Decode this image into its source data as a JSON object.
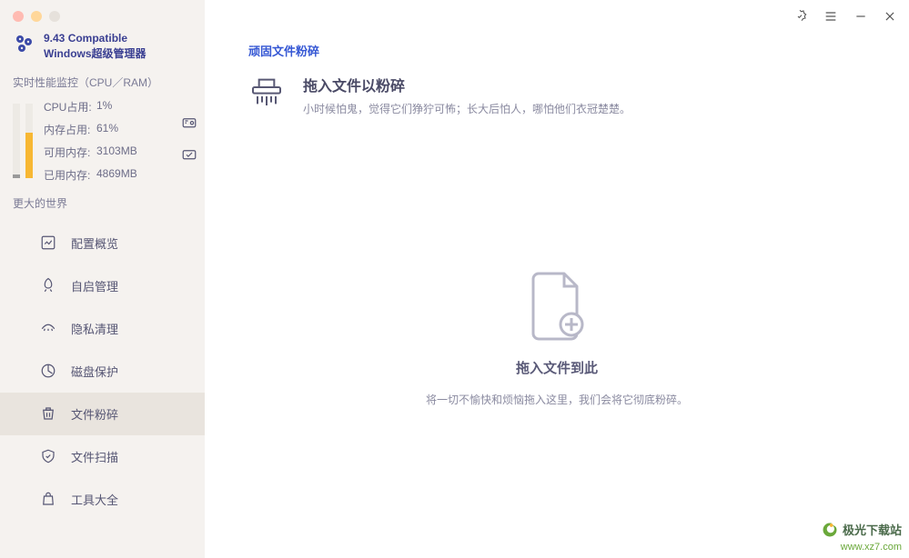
{
  "app": {
    "title_line1": "9.43 Compatible",
    "title_line2": "Windows超级管理器"
  },
  "monitor": {
    "section_label": "实时性能监控（CPU／RAM）",
    "metrics": {
      "cpu": {
        "label": "CPU占用:",
        "value": "1%"
      },
      "mem": {
        "label": "内存占用:",
        "value": "61%"
      },
      "free": {
        "label": "可用内存:",
        "value": "3103MB"
      },
      "used": {
        "label": "已用内存:",
        "value": "4869MB"
      }
    }
  },
  "world": {
    "section_label": "更大的世界"
  },
  "nav": {
    "items": [
      {
        "label": "配置概览",
        "icon": "dashboard"
      },
      {
        "label": "自启管理",
        "icon": "rocket"
      },
      {
        "label": "隐私清理",
        "icon": "eye"
      },
      {
        "label": "磁盘保护",
        "icon": "disk"
      },
      {
        "label": "文件粉碎",
        "icon": "trash",
        "active": true
      },
      {
        "label": "文件扫描",
        "icon": "shield"
      },
      {
        "label": "工具大全",
        "icon": "toolbox"
      }
    ]
  },
  "main": {
    "crumb": "顽固文件粉碎",
    "header_title": "拖入文件以粉碎",
    "header_sub": "小时候怕鬼，觉得它们狰狞可怖；长大后怕人，哪怕他们衣冠楚楚。",
    "drop_title": "拖入文件到此",
    "drop_sub": "将一切不愉快和烦恼拖入这里，我们会将它彻底粉碎。"
  },
  "watermark": {
    "line1": "极光下载站",
    "line2": "www.xz7.com"
  }
}
